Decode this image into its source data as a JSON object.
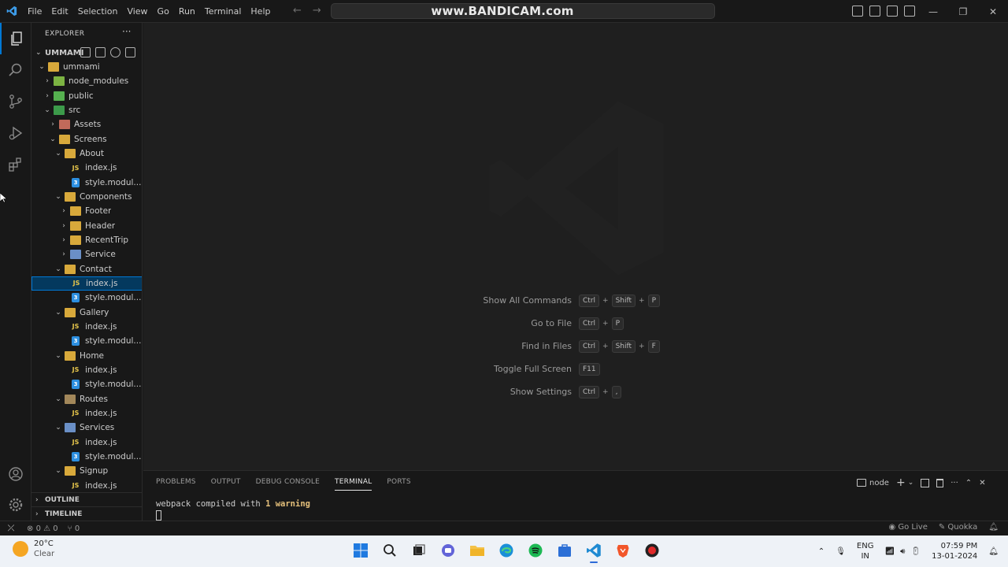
{
  "titlebar": {
    "menu": [
      "File",
      "Edit",
      "Selection",
      "View",
      "Go",
      "Run",
      "Terminal",
      "Help"
    ],
    "watermark": "www.BANDICAM.com"
  },
  "explorer": {
    "title": "EXPLORER",
    "root": "UMMAMI",
    "tree": [
      {
        "label": "ummami",
        "icon": "folder",
        "chev": "open"
      },
      {
        "label": "node_modules",
        "icon": "node",
        "chev": "closed"
      },
      {
        "label": "public",
        "icon": "pub",
        "chev": "closed"
      },
      {
        "label": "src",
        "icon": "src",
        "chev": "open"
      },
      {
        "label": "Assets",
        "icon": "assets",
        "chev": "closed"
      },
      {
        "label": "Screens",
        "icon": "folder",
        "chev": "open"
      },
      {
        "label": "About",
        "icon": "folder",
        "chev": "open"
      },
      {
        "label": "index.js",
        "icon": "js",
        "chev": ""
      },
      {
        "label": "style.modul...",
        "icon": "css",
        "chev": ""
      },
      {
        "label": "Components",
        "icon": "comp",
        "chev": "open"
      },
      {
        "label": "Footer",
        "icon": "folder",
        "chev": "closed"
      },
      {
        "label": "Header",
        "icon": "folder",
        "chev": "closed"
      },
      {
        "label": "RecentTrip",
        "icon": "folder",
        "chev": "closed"
      },
      {
        "label": "Service",
        "icon": "svc",
        "chev": "closed"
      },
      {
        "label": "Contact",
        "icon": "folder",
        "chev": "open"
      },
      {
        "label": "index.js",
        "icon": "js",
        "chev": "",
        "selected": true
      },
      {
        "label": "style.modul...",
        "icon": "css",
        "chev": ""
      },
      {
        "label": "Gallery",
        "icon": "folder",
        "chev": "open"
      },
      {
        "label": "index.js",
        "icon": "js",
        "chev": ""
      },
      {
        "label": "style.modul...",
        "icon": "css",
        "chev": ""
      },
      {
        "label": "Home",
        "icon": "folder",
        "chev": "open"
      },
      {
        "label": "index.js",
        "icon": "js",
        "chev": ""
      },
      {
        "label": "style.modul...",
        "icon": "css",
        "chev": ""
      },
      {
        "label": "Routes",
        "icon": "routes",
        "chev": "open"
      },
      {
        "label": "index.js",
        "icon": "js",
        "chev": ""
      },
      {
        "label": "Services",
        "icon": "svc",
        "chev": "open"
      },
      {
        "label": "index.js",
        "icon": "js",
        "chev": ""
      },
      {
        "label": "style.modul...",
        "icon": "css",
        "chev": ""
      },
      {
        "label": "Signup",
        "icon": "folder",
        "chev": "open"
      },
      {
        "label": "index.js",
        "icon": "js",
        "chev": ""
      }
    ],
    "outline": "OUTLINE",
    "timeline": "TIMELINE"
  },
  "shortcuts": [
    {
      "label": "Show All Commands",
      "keys": [
        "Ctrl",
        "Shift",
        "P"
      ]
    },
    {
      "label": "Go to File",
      "keys": [
        "Ctrl",
        "P"
      ]
    },
    {
      "label": "Find in Files",
      "keys": [
        "Ctrl",
        "Shift",
        "F"
      ]
    },
    {
      "label": "Toggle Full Screen",
      "keys": [
        "F11"
      ]
    },
    {
      "label": "Show Settings",
      "keys": [
        "Ctrl",
        ","
      ]
    }
  ],
  "panel": {
    "tabs": [
      "PROBLEMS",
      "OUTPUT",
      "DEBUG CONSOLE",
      "TERMINAL",
      "PORTS"
    ],
    "active_tab": "TERMINAL",
    "terminal_name": "node",
    "line_prefix": "webpack compiled with ",
    "line_warn": "1 warning"
  },
  "statusbar": {
    "errors": "0",
    "warnings": "0",
    "ports": "0",
    "golive": "Go Live",
    "quokka": "Quokka"
  },
  "taskbar": {
    "temp": "20°C",
    "condition": "Clear",
    "lang": "ENG",
    "region": "IN",
    "time": "07:59 PM",
    "date": "13-01-2024"
  }
}
